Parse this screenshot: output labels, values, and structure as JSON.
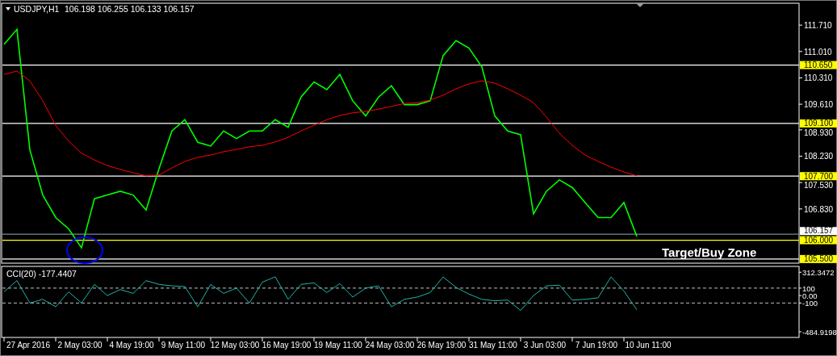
{
  "main_chart": {
    "quote": "106.198 106.255 106.133 106.157",
    "chart_data": {
      "type": "line",
      "title": "USDJPY,H1",
      "ylim": [
        105.39,
        112.27
      ],
      "series": [
        {
          "color": "#00ff00",
          "values": [
            111.2,
            111.6,
            108.4,
            107.2,
            106.6,
            106.3,
            105.8,
            107.1,
            107.2,
            107.3,
            107.2,
            106.8,
            107.9,
            108.9,
            109.2,
            108.6,
            108.5,
            108.9,
            108.7,
            108.9,
            108.9,
            109.2,
            109.0,
            109.8,
            110.2,
            110.0,
            110.4,
            109.7,
            109.3,
            109.8,
            110.1,
            109.6,
            109.6,
            109.7,
            110.9,
            111.3,
            111.1,
            110.6,
            109.3,
            108.9,
            108.8,
            106.7,
            107.3,
            107.6,
            107.4,
            107.0,
            106.6,
            106.6,
            107.0,
            106.1
          ]
        },
        {
          "color": "#ff0000",
          "values": [
            110.4,
            110.49,
            110.23,
            109.7,
            109.05,
            108.63,
            108.31,
            108.13,
            107.98,
            107.88,
            107.79,
            107.71,
            107.73,
            107.92,
            108.09,
            108.2,
            108.26,
            108.35,
            108.41,
            108.48,
            108.52,
            108.61,
            108.73,
            108.9,
            109.05,
            109.2,
            109.31,
            109.38,
            109.42,
            109.48,
            109.55,
            109.63,
            109.65,
            109.72,
            109.85,
            110.02,
            110.15,
            110.23,
            110.17,
            110.02,
            109.85,
            109.65,
            109.27,
            108.84,
            108.52,
            108.26,
            108.09,
            107.94,
            107.81,
            107.71
          ]
        }
      ],
      "yticks": [
        {
          "value": 111.71,
          "label": "111.710"
        },
        {
          "value": 111.01,
          "label": "111.010"
        },
        {
          "value": 110.31,
          "label": "110.310"
        },
        {
          "value": 109.61,
          "label": "109.610"
        },
        {
          "value": 108.93,
          "label": "108.930"
        },
        {
          "value": 108.23,
          "label": "108.230"
        },
        {
          "value": 107.53,
          "label": "107.530"
        },
        {
          "value": 106.83,
          "label": "106.830"
        }
      ],
      "ref_lines": [
        {
          "axis": "y",
          "value": 110.65,
          "label": "110.650",
          "color": "#ffffff"
        },
        {
          "axis": "y",
          "value": 109.1,
          "label": "109.100",
          "color": "#ffffff"
        },
        {
          "axis": "y",
          "value": 107.7,
          "label": "107.700",
          "color": "#ffffff"
        },
        {
          "axis": "y",
          "value": 106.157,
          "label": "106.157",
          "color": "#778899"
        },
        {
          "axis": "y",
          "value": 106.0,
          "label": "106.000",
          "color": "#ffff00"
        },
        {
          "axis": "y",
          "value": 105.5,
          "label": "105.500",
          "color": "#ffffff"
        }
      ]
    },
    "zone_label": "Target/Buy Zone"
  },
  "indicator_panel": {
    "chart_data": {
      "type": "line",
      "title": "CCI(20) -177.4407",
      "categories": [
        null,
        null,
        "27 Apr 2016",
        null,
        null,
        null,
        "2 May 03:00",
        null,
        null,
        null,
        "4 May 19:00",
        null,
        null,
        null,
        "9 May 11:00",
        null,
        null,
        null,
        "12 May 03:00",
        null,
        null,
        null,
        "16 May 19:00",
        null,
        null,
        null,
        "19 May 11:00",
        null,
        null,
        null,
        "24 May 03:00",
        null,
        null,
        null,
        "26 May 19:00",
        null,
        null,
        null,
        "31 May 11:00",
        null,
        null,
        null,
        "3 Jun 03:00",
        null,
        null,
        null,
        "7 Jun 19:00",
        null,
        null,
        null,
        "10 Jun 11:00"
      ],
      "ylim": [
        -550,
        380
      ],
      "series": [
        {
          "color": "#20b2aa",
          "values": [
            50,
            200,
            -100,
            -50,
            -150,
            50,
            -100,
            150,
            0,
            80,
            30,
            200,
            150,
            130,
            120,
            -150,
            150,
            30,
            100,
            -100,
            180,
            250,
            -50,
            150,
            170,
            40,
            160,
            -20,
            100,
            130,
            -150,
            -50,
            -20,
            40,
            250,
            110,
            20,
            -50,
            -70,
            -60,
            -200,
            0,
            130,
            140,
            -60,
            -50,
            -30,
            250,
            60,
            -190,
            null
          ]
        }
      ],
      "yticks": [
        {
          "value": 312.3472,
          "label": "312.3472"
        },
        {
          "value": 100,
          "label": "100"
        },
        {
          "value": 0,
          "label": "0.00"
        },
        {
          "value": -100,
          "label": "-100"
        },
        {
          "value": -484.9198,
          "label": "-484.9198"
        }
      ]
    }
  }
}
